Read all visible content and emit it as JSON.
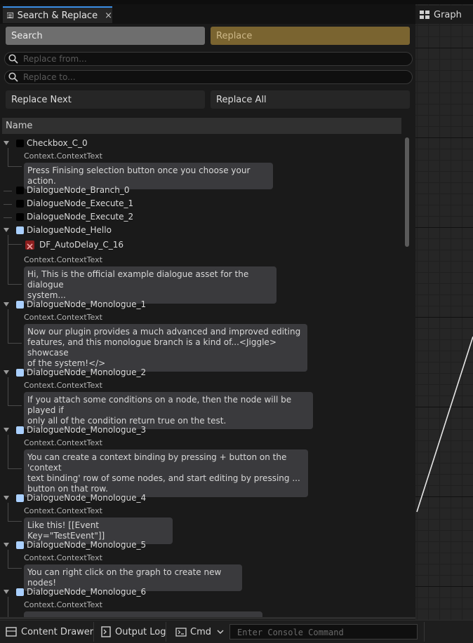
{
  "tab": {
    "title": "Search & Replace",
    "close": "×"
  },
  "modes": {
    "search": "Search",
    "replace": "Replace"
  },
  "fields": {
    "replace_from_placeholder": "Replace from...",
    "replace_to_placeholder": "Replace to..."
  },
  "actions": {
    "replace_next": "Replace Next",
    "replace_all": "Replace All"
  },
  "table": {
    "header": "Name"
  },
  "tree": {
    "context_label": "Context.ContextText",
    "nodes": [
      {
        "name": "Checkbox_C_0",
        "color": "#000000",
        "text": "Press Finising selection button once you choose your action."
      },
      {
        "name": "DialogueNode_Branch_0",
        "color": "#000000"
      },
      {
        "name": "DialogueNode_Execute_1",
        "color": "#000000"
      },
      {
        "name": "DialogueNode_Execute_2",
        "color": "#000000"
      },
      {
        "name": "DialogueNode_Hello",
        "color": "#aad0ff",
        "child": "DF_AutoDelay_C_16",
        "text_lines": [
          "Hi, This is the official example dialogue asset for the dialogue",
          "system..."
        ]
      },
      {
        "name": "DialogueNode_Monologue_1",
        "color": "#aad0ff",
        "text_lines": [
          "Now our plugin provides a much advanced and improved editing",
          "features, and this monologue branch is a kind of...<Jiggle> showcase",
          "of the system!</>"
        ]
      },
      {
        "name": "DialogueNode_Monologue_2",
        "color": "#aad0ff",
        "text_lines": [
          "If you attach some conditions on a node, then the node will be played if",
          "only all of the condition return true on the test."
        ]
      },
      {
        "name": "DialogueNode_Monologue_3",
        "color": "#aad0ff",
        "text_lines": [
          "You can create a context binding by pressing + button on the 'context",
          "text binding' row of some nodes, and start editing by pressing ...",
          "button on that row."
        ]
      },
      {
        "name": "DialogueNode_Monologue_4",
        "color": "#aad0ff",
        "text": "Like this! [[Event Key=\"TestEvent\"]]"
      },
      {
        "name": "DialogueNode_Monologue_5",
        "color": "#aad0ff",
        "text": "You can right click on the graph to create new nodes!"
      },
      {
        "name": "DialogueNode_Monologue_6",
        "color": "#aad0ff"
      }
    ]
  },
  "graph": {
    "tab_label": "Graph"
  },
  "bottom": {
    "content_drawer": "Content Drawer",
    "output_log": "Output Log",
    "cmd": "Cmd",
    "console_placeholder": "Enter Console Command"
  },
  "colors": {
    "accent": "#3a8ee6",
    "replace_mode": "#7a6430",
    "node_blue": "#aad0ff"
  }
}
